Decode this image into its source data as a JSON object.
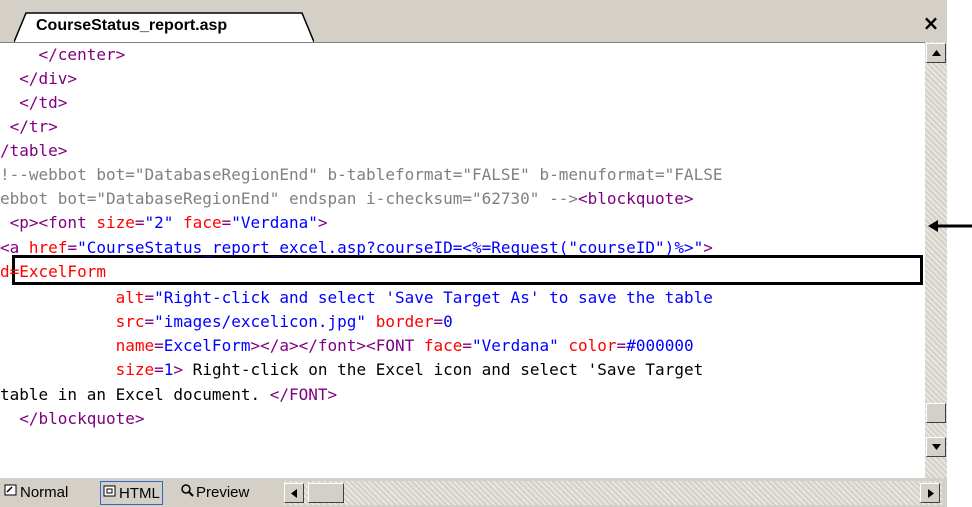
{
  "tab": {
    "title": "CourseStatus_report.asp",
    "close_glyph": "×"
  },
  "code_lines": [
    {
      "seg": [
        {
          "c": "tag",
          "t": "    </center>"
        }
      ]
    },
    {
      "seg": [
        {
          "c": "tag",
          "t": "  </div>"
        }
      ]
    },
    {
      "seg": [
        {
          "c": "tag",
          "t": "  </td>"
        }
      ]
    },
    {
      "seg": [
        {
          "c": "tag",
          "t": " </tr>"
        }
      ]
    },
    {
      "seg": [
        {
          "c": "tag",
          "t": "/table>"
        }
      ]
    },
    {
      "seg": [
        {
          "c": "comment",
          "t": "!--webbot bot=\"DatabaseRegionEnd\" b-tableformat=\"FALSE\" b-menuformat=\"FALSE"
        }
      ]
    },
    {
      "seg": [
        {
          "c": "comment",
          "t": "ebbot bot=\"DatabaseRegionEnd\" endspan i-checksum=\"62730\" -->"
        },
        {
          "c": "tag",
          "t": "<blockquote>"
        }
      ]
    },
    {
      "seg": [
        {
          "c": "tag",
          "t": " <p><font "
        },
        {
          "c": "attr",
          "t": "size"
        },
        {
          "c": "tag",
          "t": "="
        },
        {
          "c": "val",
          "t": "\"2\""
        },
        {
          "c": "tag",
          "t": " "
        },
        {
          "c": "attr",
          "t": "face"
        },
        {
          "c": "tag",
          "t": "="
        },
        {
          "c": "val",
          "t": "\"Verdana\""
        },
        {
          "c": "tag",
          "t": ">"
        }
      ]
    },
    {
      "seg": [
        {
          "c": "tag",
          "t": "<a "
        },
        {
          "c": "attr",
          "t": "href"
        },
        {
          "c": "tag",
          "t": "="
        },
        {
          "c": "val",
          "t": "\"CourseStatus_report_excel.asp?courseID=<%=Request(\"courseID\")%>\""
        },
        {
          "c": "tag",
          "t": ">"
        }
      ]
    },
    {
      "seg": [
        {
          "c": "attr",
          "t": "d=ExcelForm"
        }
      ]
    },
    {
      "seg": [
        {
          "c": "text",
          "t": "            "
        },
        {
          "c": "attr",
          "t": "alt"
        },
        {
          "c": "tag",
          "t": "="
        },
        {
          "c": "val",
          "t": "\"Right-click and select 'Save Target As' to save the table"
        }
      ]
    },
    {
      "seg": [
        {
          "c": "text",
          "t": "            "
        },
        {
          "c": "attr",
          "t": "src"
        },
        {
          "c": "tag",
          "t": "="
        },
        {
          "c": "val",
          "t": "\"images/excelicon.jpg\""
        },
        {
          "c": "tag",
          "t": " "
        },
        {
          "c": "attr",
          "t": "border"
        },
        {
          "c": "tag",
          "t": "="
        },
        {
          "c": "val",
          "t": "0"
        }
      ]
    },
    {
      "seg": [
        {
          "c": "text",
          "t": "            "
        },
        {
          "c": "attr",
          "t": "name"
        },
        {
          "c": "tag",
          "t": "="
        },
        {
          "c": "val",
          "t": "ExcelForm"
        },
        {
          "c": "tag",
          "t": "></a></font><FONT "
        },
        {
          "c": "attr",
          "t": "face"
        },
        {
          "c": "tag",
          "t": "="
        },
        {
          "c": "val",
          "t": "\"Verdana\""
        },
        {
          "c": "tag",
          "t": " "
        },
        {
          "c": "attr",
          "t": "color"
        },
        {
          "c": "tag",
          "t": "="
        },
        {
          "c": "val",
          "t": "#000000"
        }
      ]
    },
    {
      "seg": [
        {
          "c": "text",
          "t": "            "
        },
        {
          "c": "attr",
          "t": "size"
        },
        {
          "c": "tag",
          "t": "="
        },
        {
          "c": "val",
          "t": "1"
        },
        {
          "c": "tag",
          "t": ">"
        },
        {
          "c": "text",
          "t": " Right-click on the Excel icon and select 'Save Target"
        }
      ]
    },
    {
      "seg": [
        {
          "c": "text",
          "t": "table in an Excel document. "
        },
        {
          "c": "tag",
          "t": "</FONT>"
        }
      ]
    },
    {
      "seg": [
        {
          "c": "tag",
          "t": "  </blockquote>"
        }
      ]
    }
  ],
  "view_tabs": [
    {
      "label": "Normal",
      "icon": "normal-view-icon"
    },
    {
      "label": "HTML",
      "icon": "html-view-icon",
      "active": true
    },
    {
      "label": "Preview",
      "icon": "preview-view-icon"
    }
  ],
  "colors": {
    "tag": "#800080",
    "attr": "#ff0000",
    "value": "#0000ff",
    "comment": "#808080",
    "highlight_border": "#000000"
  }
}
